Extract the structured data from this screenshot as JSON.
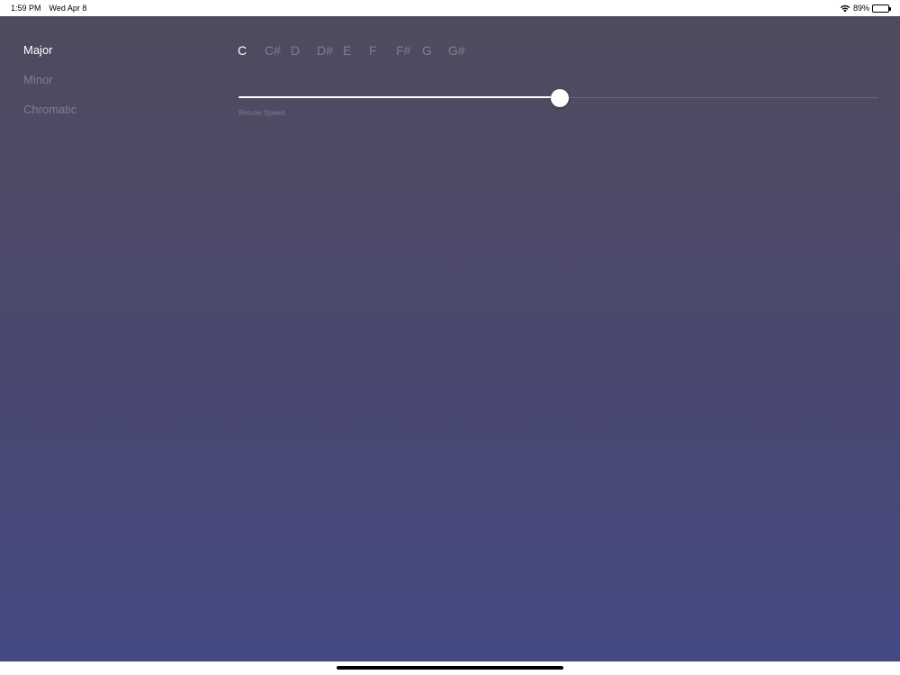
{
  "status_bar": {
    "time": "1:59 PM",
    "date": "Wed Apr 8",
    "battery": "89%",
    "battery_level": 0.89,
    "icons": [
      "wifi-icon",
      "battery-icon"
    ]
  },
  "scales": {
    "items": [
      {
        "label": "Major",
        "active": true
      },
      {
        "label": "Minor",
        "active": false
      },
      {
        "label": "Chromatic",
        "active": false
      }
    ]
  },
  "notes": {
    "items": [
      {
        "label": "C",
        "active": true
      },
      {
        "label": "C#",
        "active": false
      },
      {
        "label": "D",
        "active": false
      },
      {
        "label": "D#",
        "active": false
      },
      {
        "label": "E",
        "active": false
      },
      {
        "label": "F",
        "active": false
      },
      {
        "label": "F#",
        "active": false
      },
      {
        "label": "G",
        "active": false
      },
      {
        "label": "G#",
        "active": false
      }
    ]
  },
  "retune": {
    "label": "Retune Speed",
    "value": 0.502
  },
  "colors": {
    "active_text": "#ffffff",
    "inactive_text": "rgba(255,255,255,0.28)",
    "gradient_top": "#4f4b5e",
    "gradient_bottom": "#434a82"
  }
}
